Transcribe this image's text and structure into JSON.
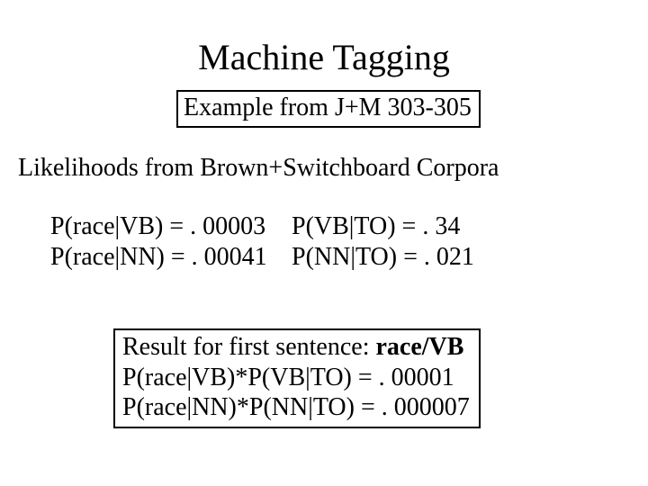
{
  "title": "Machine Tagging",
  "example_box": "Example from J+M 303-305",
  "likelihoods_heading": "Likelihoods from Brown+Switchboard Corpora",
  "left": {
    "l1": "P(race|VB) = . 00003",
    "l2": "P(race|NN) = . 00041"
  },
  "right": {
    "l1": "P(VB|TO) = . 34",
    "l2": "P(NN|TO) = . 021"
  },
  "result": {
    "line1_prefix": "Result for first sentence:  ",
    "line1_bold": "race/VB",
    "line2": "P(race|VB)*P(VB|TO) = . 00001",
    "line3": "P(race|NN)*P(NN|TO) = . 000007"
  }
}
